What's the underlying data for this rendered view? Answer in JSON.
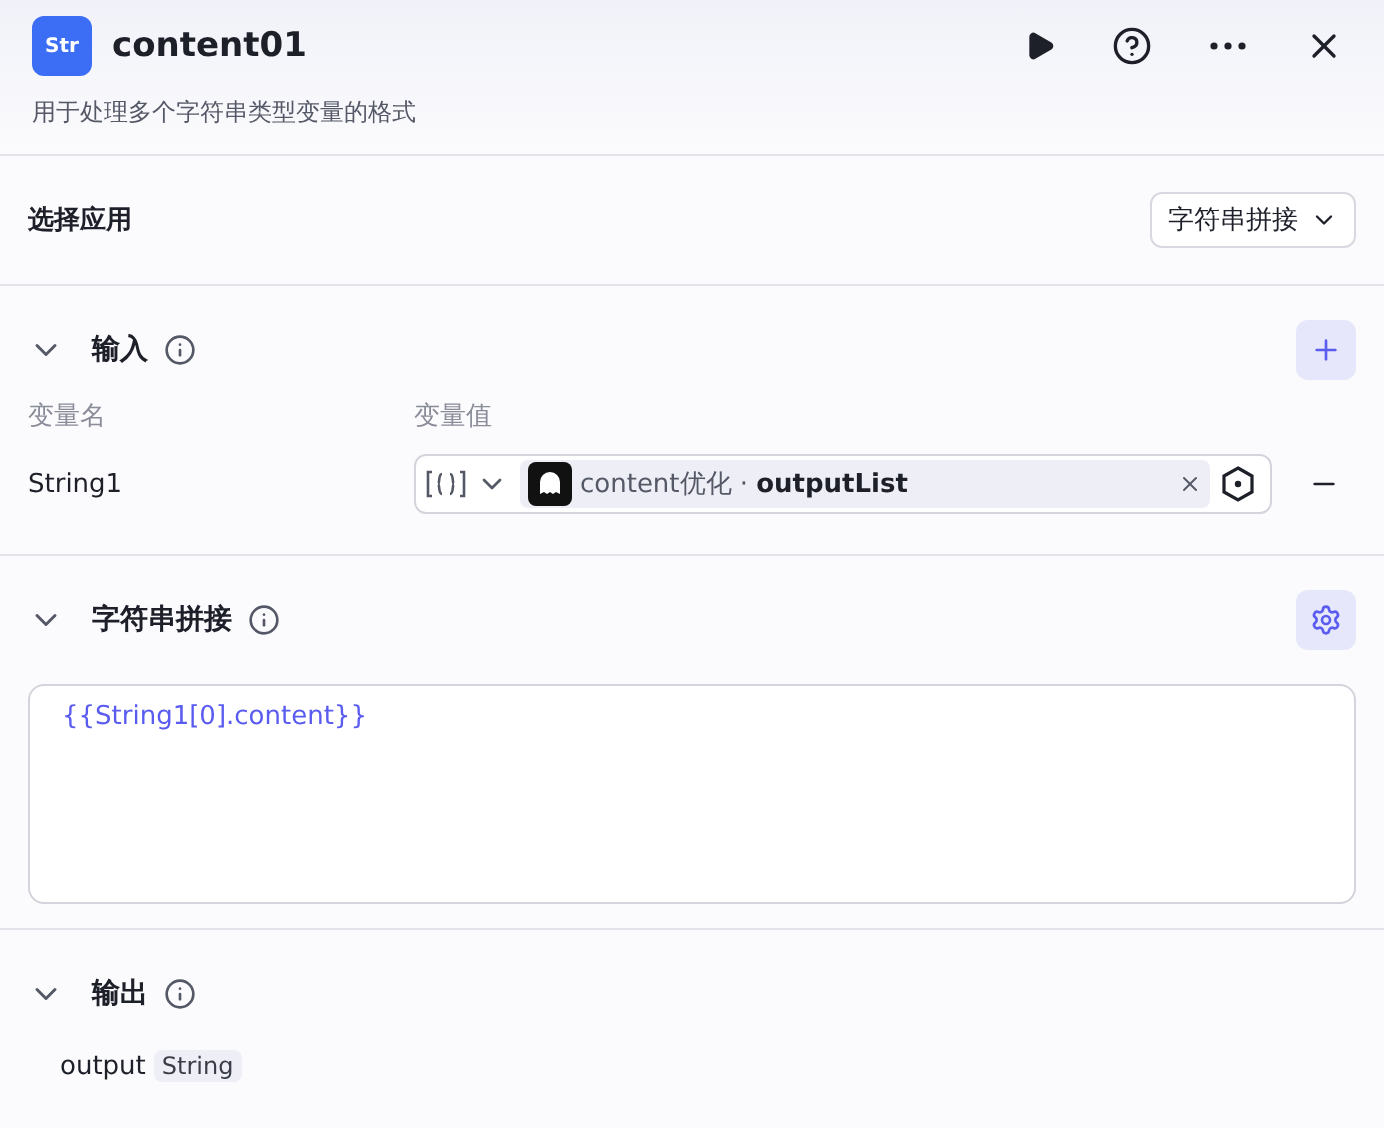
{
  "header": {
    "logo_text": "Str",
    "title": "content01",
    "description": "用于处理多个字符串类型变量的格式"
  },
  "app_select": {
    "label": "选择应用",
    "value": "字符串拼接"
  },
  "input_section": {
    "title": "输入",
    "expanded": true,
    "columns": [
      "变量名",
      "变量值"
    ],
    "rows": [
      {
        "name": "String1",
        "source": "content优化",
        "separator": "·",
        "field": "outputList"
      }
    ]
  },
  "concat_section": {
    "title": "字符串拼接",
    "expanded": true,
    "template": "{{String1[0].content}}"
  },
  "output_section": {
    "title": "输出",
    "expanded": true,
    "outputs": [
      {
        "name": "output",
        "type": "String"
      }
    ]
  }
}
